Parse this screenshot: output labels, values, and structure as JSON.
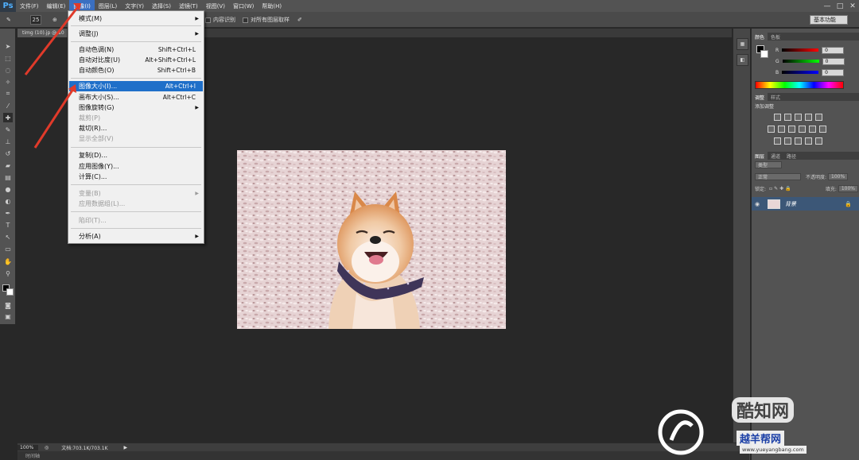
{
  "app": {
    "logo": "Ps"
  },
  "menubar": {
    "items": [
      "文件(F)",
      "编辑(E)",
      "图像(I)",
      "图层(L)",
      "文字(Y)",
      "选择(S)",
      "滤镜(T)",
      "视图(V)",
      "窗口(W)",
      "帮助(H)"
    ],
    "active_index": 2,
    "window_controls": [
      "—",
      "□",
      "✕"
    ]
  },
  "options_bar": {
    "brush_size": "25",
    "content_aware": "内容识别",
    "sample_all_layers": "对所有图层取样",
    "workspace": "基本功能"
  },
  "document": {
    "tab_title": "timg (10).jp @ 10"
  },
  "image_menu": {
    "items": [
      {
        "label": "模式(M)",
        "shortcut": "",
        "submenu": true,
        "disabled": false,
        "highlight": false
      },
      {
        "label": "调整(J)",
        "shortcut": "",
        "submenu": true,
        "disabled": false,
        "highlight": false
      },
      {
        "label": "自动色调(N)",
        "shortcut": "Shift+Ctrl+L",
        "submenu": false,
        "disabled": false,
        "highlight": false
      },
      {
        "label": "自动对比度(U)",
        "shortcut": "Alt+Shift+Ctrl+L",
        "submenu": false,
        "disabled": false,
        "highlight": false
      },
      {
        "label": "自动颜色(O)",
        "shortcut": "Shift+Ctrl+B",
        "submenu": false,
        "disabled": false,
        "highlight": false
      },
      {
        "label": "图像大小(I)...",
        "shortcut": "Alt+Ctrl+I",
        "submenu": false,
        "disabled": false,
        "highlight": true
      },
      {
        "label": "画布大小(S)...",
        "shortcut": "Alt+Ctrl+C",
        "submenu": false,
        "disabled": false,
        "highlight": false
      },
      {
        "label": "图像旋转(G)",
        "shortcut": "",
        "submenu": true,
        "disabled": false,
        "highlight": false
      },
      {
        "label": "裁剪(P)",
        "shortcut": "",
        "submenu": false,
        "disabled": true,
        "highlight": false
      },
      {
        "label": "裁切(R)...",
        "shortcut": "",
        "submenu": false,
        "disabled": false,
        "highlight": false
      },
      {
        "label": "显示全部(V)",
        "shortcut": "",
        "submenu": false,
        "disabled": true,
        "highlight": false
      },
      {
        "label": "复制(D)...",
        "shortcut": "",
        "submenu": false,
        "disabled": false,
        "highlight": false
      },
      {
        "label": "应用图像(Y)...",
        "shortcut": "",
        "submenu": false,
        "disabled": false,
        "highlight": false
      },
      {
        "label": "计算(C)...",
        "shortcut": "",
        "submenu": false,
        "disabled": false,
        "highlight": false
      },
      {
        "label": "变量(B)",
        "shortcut": "",
        "submenu": true,
        "disabled": true,
        "highlight": false
      },
      {
        "label": "应用数据组(L)...",
        "shortcut": "",
        "submenu": false,
        "disabled": true,
        "highlight": false
      },
      {
        "label": "陷印(T)...",
        "shortcut": "",
        "submenu": false,
        "disabled": true,
        "highlight": false
      },
      {
        "label": "分析(A)",
        "shortcut": "",
        "submenu": true,
        "disabled": false,
        "highlight": false
      }
    ]
  },
  "status_bar": {
    "zoom": "100%",
    "doc_info": "文档:703.1K/703.1K",
    "timeline": "时间轴"
  },
  "color_panel": {
    "tabs": [
      "颜色",
      "色板"
    ],
    "channels": [
      {
        "label": "R",
        "value": "0"
      },
      {
        "label": "G",
        "value": "0"
      },
      {
        "label": "B",
        "value": "0"
      }
    ]
  },
  "adjust_panel": {
    "tabs": [
      "调整",
      "样式"
    ],
    "title": "添加调整"
  },
  "layers_panel": {
    "tabs": [
      "图层",
      "通道",
      "路径"
    ],
    "kind": "类型",
    "blend_mode": "正常",
    "opacity_label": "不透明度:",
    "opacity": "100%",
    "lock_label": "锁定:",
    "fill_label": "填充:",
    "fill": "100%",
    "layer_name": "背景"
  },
  "watermark": {
    "site1": "酷知网",
    "site2": "越羊帮网",
    "url": "www.yueyangbang.com"
  },
  "colors": {
    "menu_highlight": "#1f6fc9",
    "annotation_arrow": "#e03a2a"
  }
}
